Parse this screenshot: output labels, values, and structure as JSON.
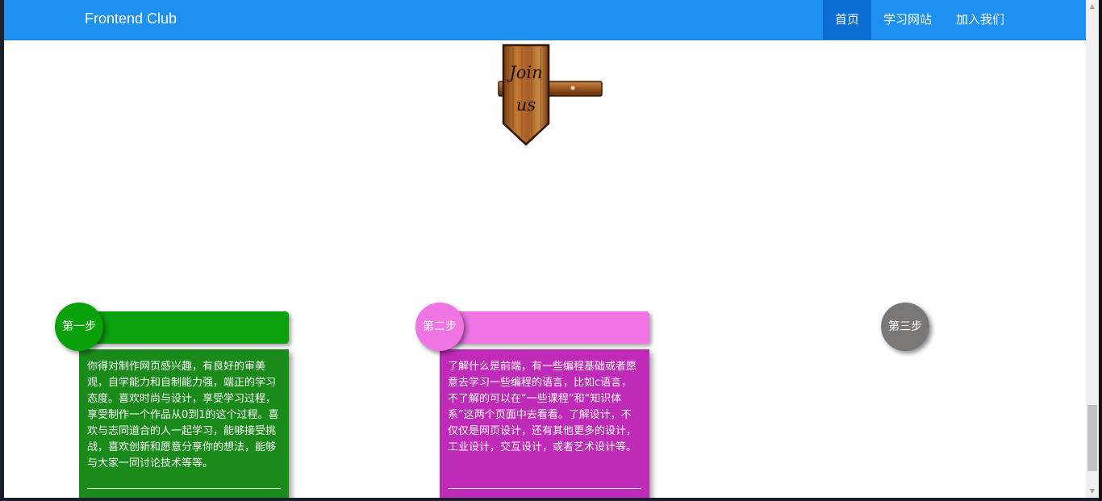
{
  "navbar": {
    "brand": "Frontend Club",
    "links": [
      {
        "label": "首页",
        "active": true
      },
      {
        "label": "学习网站",
        "active": false
      },
      {
        "label": "加入我们",
        "active": false
      }
    ]
  },
  "sign": {
    "line1": "Join",
    "line2": "us"
  },
  "steps": [
    {
      "label": "第一步",
      "text": "你得对制作网页感兴趣，有良好的审美观，自学能力和自制能力强，端正的学习态度。喜欢时尚与设计，享受学习过程，享受制作一个作品从0到1的这个过程。喜欢与志同道合的人一起学习，能够接受挑战，喜欢创新和愿意分享你的想法，能够与大家一同讨论技术等等。",
      "circle_color": "#08a10a",
      "header_color": "#0ba10e",
      "body_color": "#1a8a1a"
    },
    {
      "label": "第二步",
      "text": "了解什么是前端，有一些编程基础或者愿意去学习一些编程的语言，比如c语言，不了解的可以在“一些课程”和“知识体系”这两个页面中去看看。了解设计，不仅仅是网页设计，还有其他更多的设计，工业设计，交互设计，或者艺术设计等。",
      "circle_color": "#f074e4",
      "header_color": "#f074e6",
      "body_color": "#c02ab8"
    },
    {
      "label": "第三步",
      "circle_color": "#7a7777"
    }
  ],
  "scrollbar": {
    "up_icon": "triangle-up-icon",
    "down_icon": "triangle-down-icon"
  }
}
